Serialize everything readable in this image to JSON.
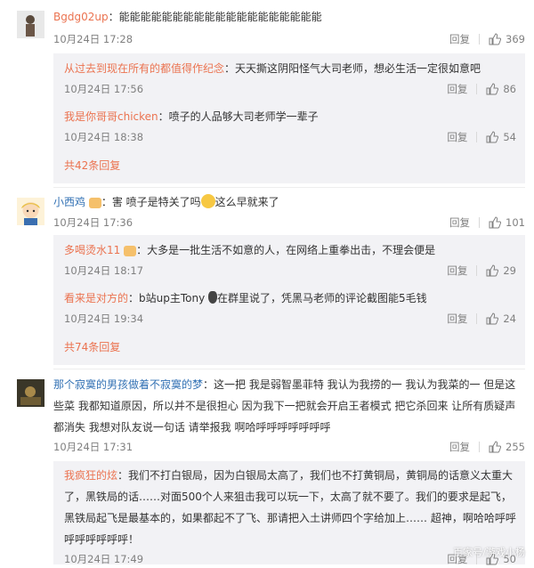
{
  "comments": [
    {
      "user": "Bgdg02up",
      "text": "：能能能能能能能能能能能能能能能能能能能",
      "time": "10月24日 17:28",
      "reply": "回复",
      "likes": "369",
      "subs": [
        {
          "user": "从过去到现在所有的都值得作纪念",
          "text": "：天天撕这阴阳怪气大司老师，想必生活一定很如意吧",
          "time": "10月24日 17:56",
          "reply": "回复",
          "likes": "86"
        },
        {
          "user": "我是你哥哥chicken",
          "text": "：喷子的人品够大司老师学一辈子",
          "time": "10月24日 18:38",
          "reply": "回复",
          "likes": "54"
        }
      ],
      "more": "共42条回复"
    },
    {
      "user": "小西鸡",
      "text_a": "：害 喷子是特关了吗",
      "text_b": "这么早就来了",
      "time": "10月24日 17:36",
      "reply": "回复",
      "likes": "101",
      "subs": [
        {
          "user": "多喝烫水11",
          "text": "：大多是一批生活不如意的人，在网络上重拳出击，不理会便是",
          "time": "10月24日 18:17",
          "reply": "回复",
          "likes": "29"
        },
        {
          "user": "看来是对方的",
          "text": "：b站up主Tony",
          "text_b": "在群里说了，凭黑马老师的评论截图能5毛钱",
          "time": "10月24日 19:34",
          "reply": "回复",
          "likes": "24"
        }
      ],
      "more": "共74条回复"
    },
    {
      "user": "那个寂寞的男孩做着不寂寞的梦",
      "text": "：这一把 我是弱智墨菲特 我认为我捞的一 我认为我菜的一 但是这些菜 我都知道原因，所以并不是很担心 因为我下一把就会开启王者模式 把它杀回来 让所有质疑声都消失 我想对队友说一句话 请举报我 啊哈呼呼呼呼呼呼呼",
      "time": "10月24日 17:31",
      "reply": "回复",
      "likes": "255",
      "subs": [
        {
          "user": "我疯狂的炫",
          "text": "：我们不打白银局，因为白银局太高了，我们也不打黄铜局，黄铜局的话意义太重大了，黑铁局的话……对面500个人来狙击我可以玩一下，太高了就不要了。我们的要求是起飞，黑铁局起飞是最基本的，如果都起不了飞、那请把入土讲师四个字给加上…… 超神，啊哈哈呼呼呼呼呼呼呼呼！",
          "time": "10月24日 17:49",
          "reply": "回复",
          "likes": "50"
        }
      ]
    }
  ],
  "watermark": "百家号/游戏小杨",
  "colors": {
    "username": "#eb7350",
    "link": "#3271b4",
    "sub_bg": "#f2f2f5",
    "meta": "#808080"
  }
}
